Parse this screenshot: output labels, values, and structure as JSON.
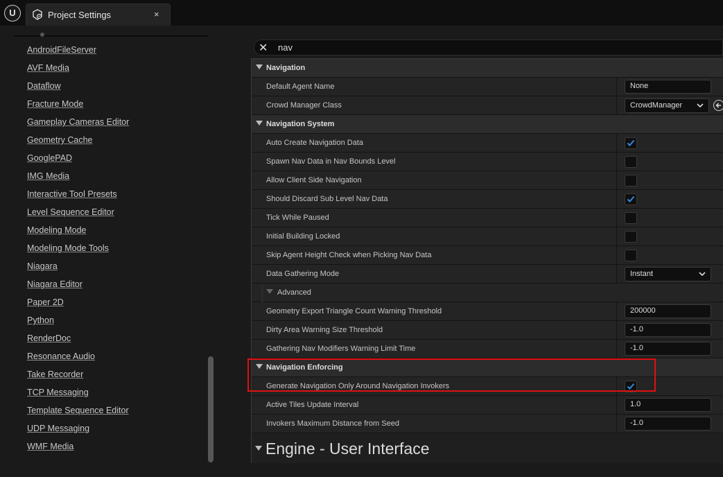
{
  "window": {
    "logo": "unreal-engine-logo",
    "tab_title": "Project Settings",
    "tab_close": "×",
    "tab_icon": "project-settings-icon"
  },
  "sidebar": {
    "items": [
      "AndroidFileServer",
      "AVF Media",
      "Dataflow",
      "Fracture Mode",
      "Gameplay Cameras Editor",
      "Geometry Cache",
      "GooglePAD",
      "IMG Media",
      "Interactive Tool Presets",
      "Level Sequence Editor",
      "Modeling Mode",
      "Modeling Mode Tools",
      "Niagara",
      "Niagara Editor",
      "Paper 2D",
      "Python",
      "RenderDoc",
      "Resonance Audio",
      "Take Recorder",
      "TCP Messaging",
      "Template Sequence Editor",
      "UDP Messaging",
      "WMF Media"
    ]
  },
  "search": {
    "value": "nav",
    "clear_icon": "close-icon"
  },
  "details": {
    "navigation": {
      "title": "Navigation",
      "default_agent_name": {
        "label": "Default Agent Name",
        "value": "None"
      },
      "crowd_manager_class": {
        "label": "Crowd Manager Class",
        "value": "CrowdManager"
      }
    },
    "navigation_system": {
      "title": "Navigation System",
      "auto_create": {
        "label": "Auto Create Navigation Data",
        "checked": true
      },
      "spawn_nav_data": {
        "label": "Spawn Nav Data in Nav Bounds Level",
        "checked": false
      },
      "allow_client_side": {
        "label": "Allow Client Side Navigation",
        "checked": false
      },
      "should_discard": {
        "label": "Should Discard Sub Level Nav Data",
        "checked": true
      },
      "tick_while_paused": {
        "label": "Tick While Paused",
        "checked": false
      },
      "initial_building_locked": {
        "label": "Initial Building Locked",
        "checked": false
      },
      "skip_agent_height": {
        "label": "Skip Agent Height Check when Picking Nav Data",
        "checked": false
      },
      "data_gathering_mode": {
        "label": "Data Gathering Mode",
        "value": "Instant"
      },
      "advanced": {
        "label": "Advanced"
      },
      "geometry_export": {
        "label": "Geometry Export Triangle Count Warning Threshold",
        "value": "200000"
      },
      "dirty_area": {
        "label": "Dirty Area Warning Size Threshold",
        "value": "-1.0"
      },
      "gathering_nav_modifiers": {
        "label": "Gathering Nav Modifiers Warning Limit Time",
        "value": "-1.0"
      }
    },
    "navigation_enforcing": {
      "title": "Navigation Enforcing",
      "generate_only_around_invokers": {
        "label": "Generate Navigation Only Around Navigation Invokers",
        "checked": true
      },
      "active_tiles_update_interval": {
        "label": "Active Tiles Update Interval",
        "value": "1.0"
      },
      "invokers_max_distance": {
        "label": "Invokers Maximum Distance from Seed",
        "value": "-1.0"
      }
    },
    "engine_ui_section": {
      "title": "Engine - User Interface"
    }
  },
  "colors": {
    "highlight": "#e01010",
    "checkmark": "#2f8be0"
  }
}
